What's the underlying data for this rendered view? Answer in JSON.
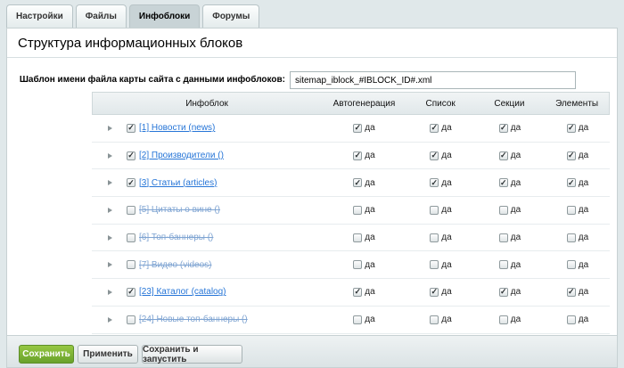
{
  "tabs": [
    {
      "label": "Настройки",
      "active": false
    },
    {
      "label": "Файлы",
      "active": false
    },
    {
      "label": "Инфоблоки",
      "active": true
    },
    {
      "label": "Форумы",
      "active": false
    }
  ],
  "panel": {
    "title": "Структура информационных блоков",
    "template_label": "Шаблон имени файла карты сайта с данными инфоблоков:",
    "template_value": "sitemap_iblock_#IBLOCK_ID#.xml"
  },
  "table": {
    "headers": {
      "name": "Инфоблок",
      "auto": "Автогенерация",
      "list": "Список",
      "sections": "Секции",
      "elements": "Элементы"
    },
    "yes_label": "да",
    "rows": [
      {
        "label": "[1] Новости (news)",
        "enabled": true,
        "checked": true,
        "auto": true,
        "list": true,
        "sections": true,
        "elements": true
      },
      {
        "label": "[2] Производители ()",
        "enabled": true,
        "checked": true,
        "auto": true,
        "list": true,
        "sections": true,
        "elements": true
      },
      {
        "label": "[3] Статьи (articles)",
        "enabled": true,
        "checked": true,
        "auto": true,
        "list": true,
        "sections": true,
        "elements": true
      },
      {
        "label": "[5] Цитаты о вине ()",
        "enabled": false,
        "checked": false,
        "auto": false,
        "list": false,
        "sections": false,
        "elements": false
      },
      {
        "label": "[6] Топ-баннеры ()",
        "enabled": false,
        "checked": false,
        "auto": false,
        "list": false,
        "sections": false,
        "elements": false
      },
      {
        "label": "[7] Видео (videos)",
        "enabled": false,
        "checked": false,
        "auto": false,
        "list": false,
        "sections": false,
        "elements": false
      },
      {
        "label": "[23] Каталог (catalog)",
        "enabled": true,
        "checked": true,
        "auto": true,
        "list": true,
        "sections": true,
        "elements": true
      },
      {
        "label": "[24] Новые топ-баннеры ()",
        "enabled": false,
        "checked": false,
        "auto": false,
        "list": false,
        "sections": false,
        "elements": false
      }
    ]
  },
  "footer": {
    "save_label": "Сохранить",
    "apply_label": "Применить",
    "save_run_label": "Сохранить и запустить"
  },
  "colors": {
    "primary_button": "#68a12b",
    "link": "#2675d7",
    "background": "#e0e8ea"
  }
}
